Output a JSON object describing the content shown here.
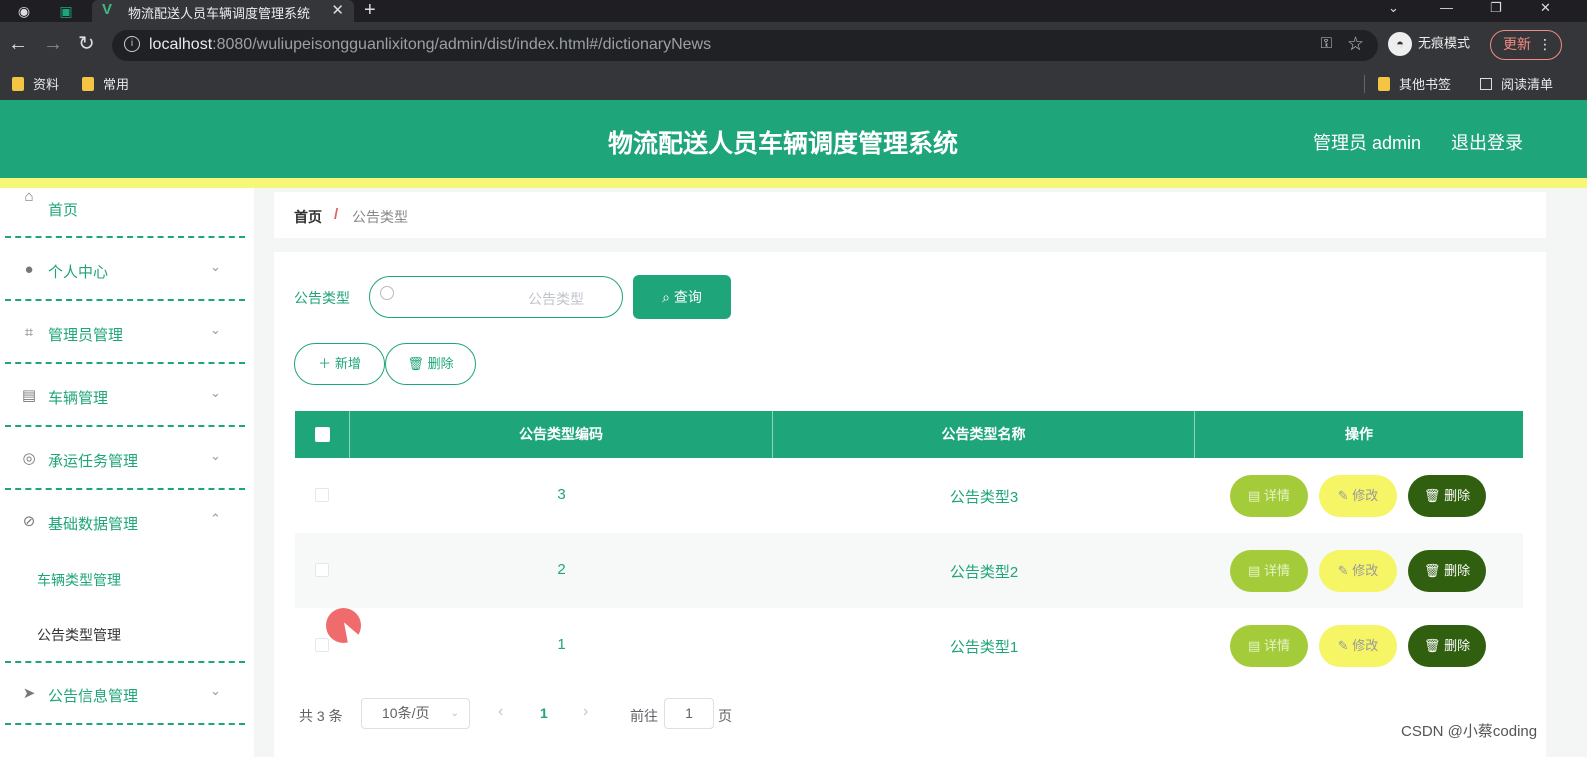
{
  "browser": {
    "tab_title": "物流配送人员车辆调度管理系统",
    "url_host": "localhost",
    "url_rest": ":8080/wuliupeisongguanlixitong/admin/dist/index.html#/dictionaryNews",
    "incognito_label": "无痕模式",
    "update_label": "更新",
    "bookmarks": [
      "资料",
      "常用"
    ],
    "bookmarks_right": [
      "其他书签",
      "阅读清单"
    ]
  },
  "header": {
    "title": "物流配送人员车辆调度管理系统",
    "user": "管理员 admin",
    "logout": "退出登录"
  },
  "sidebar": {
    "items": [
      {
        "label": "首页",
        "icon": "home-icon"
      },
      {
        "label": "个人中心",
        "icon": "user-icon"
      },
      {
        "label": "管理员管理",
        "icon": "crop-icon"
      },
      {
        "label": "车辆管理",
        "icon": "clipboard-icon"
      },
      {
        "label": "承运任务管理",
        "icon": "target-icon"
      },
      {
        "label": "基础数据管理",
        "icon": "compass-icon"
      },
      {
        "label": "公告信息管理",
        "icon": "send-icon"
      }
    ],
    "submenu": [
      "车辆类型管理",
      "公告类型管理"
    ]
  },
  "breadcrumb": {
    "home": "首页",
    "separator": "/",
    "current": "公告类型"
  },
  "search": {
    "label": "公告类型",
    "placeholder": "公告类型",
    "button": "查询"
  },
  "actions": {
    "add": "新增",
    "delete": "删除"
  },
  "table": {
    "columns": [
      "公告类型编码",
      "公告类型名称",
      "操作"
    ],
    "rows": [
      {
        "code": "3",
        "name": "公告类型3"
      },
      {
        "code": "2",
        "name": "公告类型2"
      },
      {
        "code": "1",
        "name": "公告类型1"
      }
    ],
    "row_actions": {
      "detail": "详情",
      "edit": "修改",
      "delete": "删除"
    }
  },
  "pagination": {
    "total": "共 3 条",
    "page_size": "10条/页",
    "current_page": "1",
    "goto_prefix": "前往",
    "goto_value": "1",
    "goto_suffix": "页"
  },
  "watermark": "CSDN @小蔡coding",
  "colors": {
    "primary": "#1fa57a",
    "stripe": "#f6f776",
    "detail": "#a4cc3a",
    "edit": "#f6f566",
    "delete": "#2f5f0f"
  }
}
